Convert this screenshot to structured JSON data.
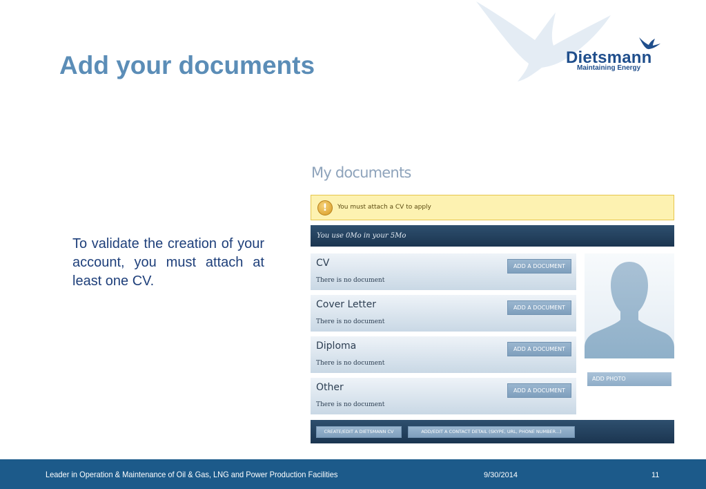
{
  "slide": {
    "title": "Add your documents",
    "body": "To validate the creation of your account, you must attach at least one CV."
  },
  "logo": {
    "name": "Dietsmann",
    "tagline": "Maintaining Energy"
  },
  "panel": {
    "heading": "My documents",
    "warning": "You must attach a CV to apply",
    "usage": "You use 0Mo in your 5Mo",
    "documents": [
      {
        "label": "CV",
        "status": "There is no document",
        "button": "ADD A DOCUMENT"
      },
      {
        "label": "Cover Letter",
        "status": "There is no document",
        "button": "ADD A DOCUMENT"
      },
      {
        "label": "Diploma",
        "status": "There is no document",
        "button": "ADD A DOCUMENT"
      },
      {
        "label": "Other",
        "status": "There is no document",
        "button": "ADD A DOCUMENT"
      }
    ],
    "add_photo": "ADD PHOTO",
    "create_cv": "CREATE/EDIT A DIETSMANN CV",
    "contact_detail": "ADD/EDIT A CONTACT DETAIL (SKYPE, URL, PHONE NUMBER...)"
  },
  "footer": {
    "tagline": "Leader in Operation & Maintenance of Oil & Gas, LNG and Power Production Facilities",
    "date": "9/30/2014",
    "page": "11"
  },
  "colors": {
    "title": "#5b8db7",
    "footer": "#1c5a8a",
    "dark_bar": "#1b3550",
    "warning_bg": "#fdf2b1"
  }
}
